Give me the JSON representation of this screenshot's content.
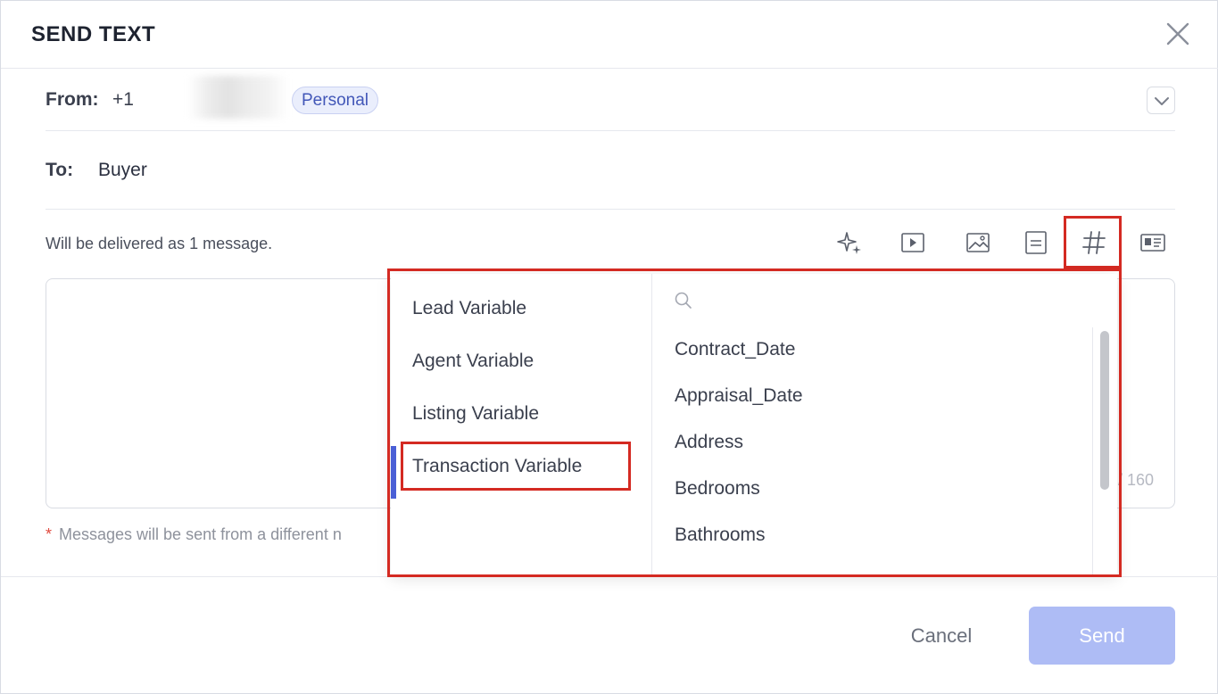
{
  "dialog": {
    "title": "SEND TEXT",
    "close_icon": "close-icon"
  },
  "from": {
    "label": "From:",
    "number_prefix": "+1",
    "badge": "Personal",
    "dropdown_icon": "chevron-down-icon"
  },
  "to": {
    "label": "To:",
    "value": "Buyer"
  },
  "compose": {
    "delivered_note": "Will be delivered as 1 message.",
    "counter": "/ 160",
    "message_value": "",
    "toolbar": [
      "sparkle-icon",
      "video-icon",
      "image-icon",
      "template-icon",
      "hash-icon",
      "contact-card-icon"
    ]
  },
  "footnote": {
    "star": "*",
    "text": "Messages will be sent from a different n"
  },
  "variable_picker": {
    "categories": [
      {
        "label": "Lead Variable"
      },
      {
        "label": "Agent Variable"
      },
      {
        "label": "Listing Variable"
      },
      {
        "label": "Transaction Variable",
        "active": true
      }
    ],
    "search_placeholder": "",
    "variables": [
      "Contract_Date",
      "Appraisal_Date",
      "Address",
      "Bedrooms",
      "Bathrooms"
    ]
  },
  "footer": {
    "cancel_label": "Cancel",
    "send_label": "Send",
    "send_color": "#aebcf5"
  },
  "highlight_color": "#d42a22",
  "accent_color": "#4a5fd6"
}
